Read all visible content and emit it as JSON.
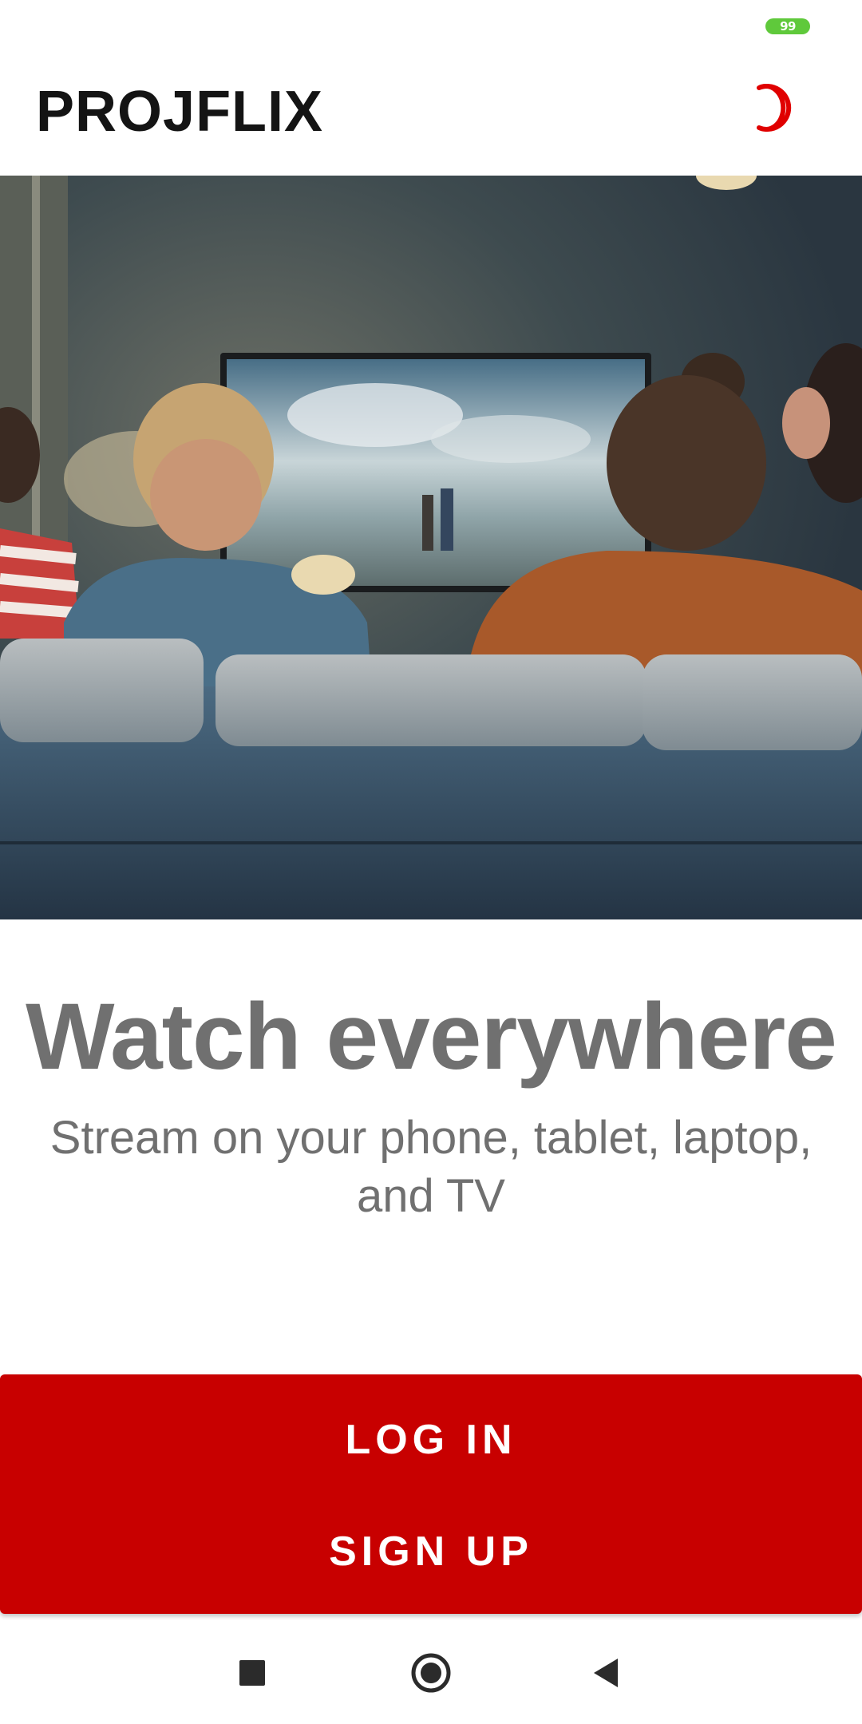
{
  "status_bar": {
    "battery_level": "99",
    "battery_color": "#5fc93b"
  },
  "app_bar": {
    "title": "PROJFLIX",
    "theme_icon": "moon-icon",
    "accent_color": "#e00000"
  },
  "hero": {
    "description_icon": "hero-photo"
  },
  "content": {
    "headline": "Watch everywhere",
    "subline": "Stream on your phone, tablet, laptop, and TV"
  },
  "actions": {
    "login_label": "LOG IN",
    "signup_label": "SIGN UP",
    "button_color": "#c80000"
  },
  "nav_bar": {
    "recents_icon": "square-icon",
    "home_icon": "circle-home-icon",
    "back_icon": "back-triangle-icon"
  }
}
